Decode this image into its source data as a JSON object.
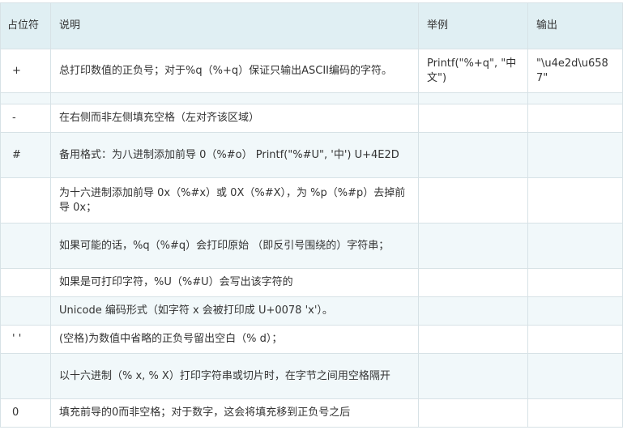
{
  "header": {
    "col1": "占位符",
    "col2": "说明",
    "col3": "举例",
    "col4": "输出"
  },
  "rows": [
    {
      "flag": "+",
      "desc": "总打印数值的正负号；对于%q（%+q）保证只输出ASCII编码的字符。",
      "example": "Printf(\"%+q\", \"中文\")",
      "output": "\"\\u4e2d\\u6587\""
    },
    {
      "flag": "",
      "desc": "",
      "example": "",
      "output": ""
    },
    {
      "flag": "-",
      "desc": "在右侧而非左侧填充空格（左对齐该区域）",
      "example": "",
      "output": ""
    },
    {
      "flag": "#",
      "desc": "备用格式：为八进制添加前导 0（%#o） Printf(\"%#U\", '中') U+4E2D",
      "example": "",
      "output": ""
    },
    {
      "flag": "",
      "desc": "为十六进制添加前导 0x（%#x）或 0X（%#X），为 %p（%#p）去掉前导 0x；",
      "example": "",
      "output": ""
    },
    {
      "flag": "",
      "desc": "如果可能的话，%q（%#q）会打印原始 （即反引号围绕的）字符串；",
      "example": "",
      "output": ""
    },
    {
      "flag": "",
      "desc": "如果是可打印字符，%U（%#U）会写出该字符的",
      "example": "",
      "output": ""
    },
    {
      "flag": "",
      "desc": "Unicode 编码形式（如字符 x 会被打印成 U+0078 'x'）。",
      "example": "",
      "output": ""
    },
    {
      "flag": "' '",
      "desc": "(空格)为数值中省略的正负号留出空白（% d）；",
      "example": "",
      "output": ""
    },
    {
      "flag": "",
      "desc": "以十六进制（% x, % X）打印字符串或切片时，在字节之间用空格隔开",
      "example": "",
      "output": ""
    },
    {
      "flag": "0",
      "desc": "填充前导的0而非空格；对于数字，这会将填充移到正负号之后",
      "example": "",
      "output": ""
    }
  ]
}
